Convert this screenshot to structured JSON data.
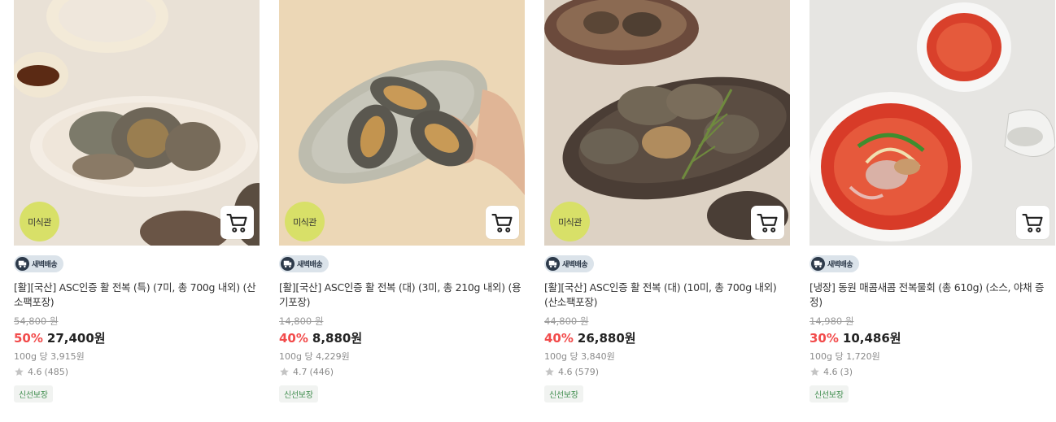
{
  "products": [
    {
      "image_alt": "abalone-on-ice-plate",
      "badge": "미식관",
      "delivery": "새벽배송",
      "title": "[활][국산] ASC인증 활 전복 (특) (7미, 총 700g 내외) (산소팩포장)",
      "original_price": "54,800 원",
      "discount": "50%",
      "price": "27,400원",
      "unit_price": "100g 당 3,915원",
      "rating": "4.6",
      "reviews": "(485)",
      "tag": "신선보장"
    },
    {
      "image_alt": "abalone-in-hand-over-plate",
      "badge": "미식관",
      "delivery": "새벽배송",
      "title": "[활][국산] ASC인증 활 전복 (대) (3미, 총 210g 내외) (용기포장)",
      "original_price": "14,800 원",
      "discount": "40%",
      "price": "8,880원",
      "unit_price": "100g 당 4,229원",
      "rating": "4.7",
      "reviews": "(446)",
      "tag": "신선보장"
    },
    {
      "image_alt": "abalone-platter-with-herbs",
      "badge": "미식관",
      "delivery": "새벽배송",
      "title": "[활][국산] ASC인증 활 전복 (대) (10미, 총 700g 내외) (산소팩포장)",
      "original_price": "44,800 원",
      "discount": "40%",
      "price": "26,880원",
      "unit_price": "100g 당 3,840원",
      "rating": "4.6",
      "reviews": "(579)",
      "tag": "신선보장"
    },
    {
      "image_alt": "spicy-abalone-cold-soup",
      "badge": "",
      "delivery": "새벽배송",
      "title": "[냉장] 동원 매콤새콤 전복물회 (총 610g) (소스, 야채 증정)",
      "original_price": "14,980 원",
      "discount": "30%",
      "price": "10,486원",
      "unit_price": "100g 당 1,720원",
      "rating": "4.6",
      "reviews": "(3)",
      "tag": "신선보장"
    }
  ],
  "icons": {
    "cart": "cart-icon",
    "star": "star-icon",
    "truck": "truck-icon"
  },
  "colors": {
    "discount": "#f24b4b",
    "badge": "#d8e068",
    "fresh": "#3f8d4e"
  }
}
